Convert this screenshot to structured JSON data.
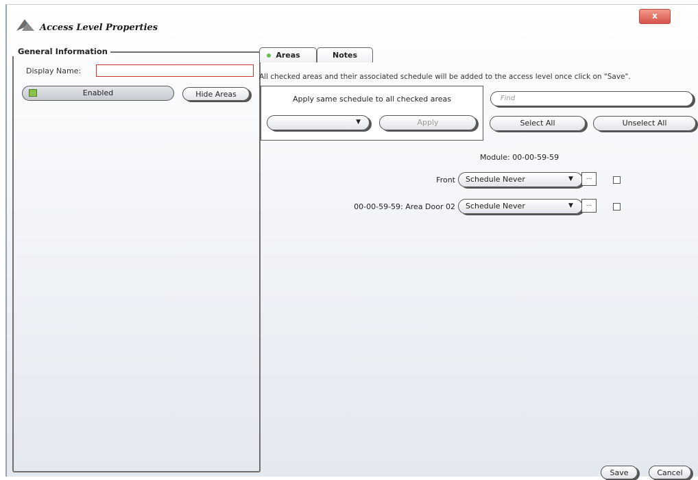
{
  "window": {
    "title": "Access Level Properties",
    "close_label": "x"
  },
  "general": {
    "legend": "General Information",
    "display_name_label": "Display Name:",
    "display_name_value": "",
    "enabled_label": "Enabled",
    "hide_areas_label": "Hide Areas"
  },
  "tabs": [
    {
      "label": "Areas"
    },
    {
      "label": "Notes"
    }
  ],
  "areas": {
    "info": "All checked areas and their associated schedule will be added to the access level once click on \"Save\".",
    "apply_title": "Apply same schedule to all checked areas",
    "apply_combo_value": "",
    "apply_label": "Apply",
    "find_placeholder": "Find",
    "select_all_label": "Select All",
    "unselect_all_label": "Unselect All",
    "module_label": "Module: 00-00-59-59",
    "rows": [
      {
        "label": "Front",
        "schedule": "Schedule Never",
        "checked": false
      },
      {
        "label": "00-00-59-59: Area Door 02",
        "schedule": "Schedule Never",
        "checked": false
      }
    ]
  },
  "footer": {
    "save_label": "Save",
    "cancel_label": "Cancel"
  },
  "icons": {
    "combo_arrow": "▼",
    "ellipsis": "..."
  }
}
